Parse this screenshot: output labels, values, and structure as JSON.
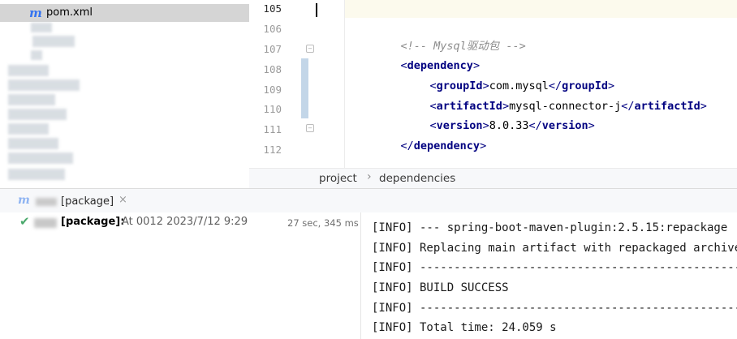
{
  "project_panel": {
    "file_icon": "m",
    "file_name": "pom.xml"
  },
  "editor": {
    "line_numbers": [
      "105",
      "106",
      "107",
      "108",
      "109",
      "110",
      "111",
      "112"
    ],
    "lines": {
      "comment": "<!-- Mysql驱动包 -->",
      "dependency_open": "dependency",
      "groupId_tag": "groupId",
      "groupId_value": "com.mysql",
      "artifactId_tag": "artifactId",
      "artifactId_value": "mysql-connector-j",
      "version_tag": "version",
      "version_value": "8.0.33",
      "dependency_close": "dependency"
    },
    "breadcrumb": [
      "project",
      "dependencies"
    ],
    "breadcrumb_separator": "›"
  },
  "run_panel": {
    "tab_icon": "m",
    "tab_label": "[package]",
    "tab_close": "×",
    "tree": {
      "status_icon": "✔",
      "label": "[package]:",
      "time_text": "At 0012 2023/7/12 9:29",
      "duration": "27 sec, 345 ms"
    },
    "console_lines": [
      "[INFO] --- spring-boot-maven-plugin:2.5.15:repackage",
      "[INFO] Replacing main artifact with repackaged archive",
      "[INFO] ------------------------------------------------------------------------",
      "[INFO] BUILD SUCCESS",
      "[INFO] ------------------------------------------------------------------------",
      "[INFO] Total time: 24.059 s"
    ]
  },
  "colors": {
    "tag": "#000080",
    "comment": "#8c8c8c",
    "maven_icon": "#3574f0",
    "success": "#4aa96c"
  }
}
